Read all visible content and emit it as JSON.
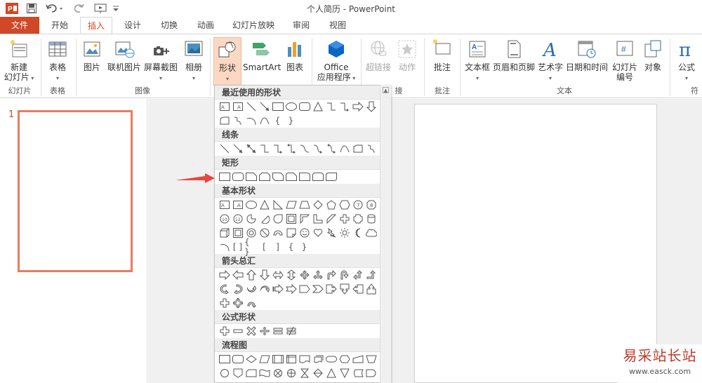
{
  "app": {
    "title": "个人简历 - PowerPoint"
  },
  "quick_access": {
    "icons": [
      "powerpoint-logo-icon",
      "save-icon",
      "undo-icon",
      "redo-icon",
      "slideshow-icon",
      "customize-icon"
    ]
  },
  "tabs": [
    {
      "label": "文件"
    },
    {
      "label": "开始"
    },
    {
      "label": "插入"
    },
    {
      "label": "设计"
    },
    {
      "label": "切换"
    },
    {
      "label": "动画"
    },
    {
      "label": "幻灯片放映"
    },
    {
      "label": "审阅"
    },
    {
      "label": "视图"
    }
  ],
  "ribbon": {
    "new_slide": {
      "line1": "新建",
      "line2": "幻灯片"
    },
    "table": "表格",
    "picture": "图片",
    "online_picture": "联机图片",
    "screenshot": "屏幕截图",
    "album": "相册",
    "shapes": "形状",
    "smartart": "SmartArt",
    "chart": "图表",
    "office": {
      "line1": "Office",
      "line2": "应用程序"
    },
    "hyperlink": "超链接",
    "action": "动作",
    "comment": "批注",
    "textbox": "文本框",
    "header_footer": "页眉和页脚",
    "wordart": "艺术字",
    "datetime": "日期和时间",
    "slide_number": {
      "line1": "幻灯片",
      "line2": "编号"
    },
    "object": "对象",
    "formula": "公式",
    "groups": {
      "slides": "幻灯片",
      "tables": "表格",
      "images": "图像",
      "links_tail": "接",
      "comments": "批注",
      "text": "文本",
      "symbols_tail": "符"
    }
  },
  "gallery": {
    "sections": {
      "recent": "最近使用的形状",
      "lines": "线条",
      "rectangles": "矩形",
      "basic": "基本形状",
      "arrows": "箭头总汇",
      "equation": "公式形状",
      "flowchart": "流程图"
    }
  },
  "thumbnails": {
    "slide_number": "1"
  },
  "watermark": {
    "title": "易采站长站",
    "url": "www.easck.com"
  },
  "colors": {
    "accent": "#d24726",
    "highlight": "#fcd8c4",
    "thumb_border": "#e97c5e",
    "arrow": "#e8473a"
  }
}
